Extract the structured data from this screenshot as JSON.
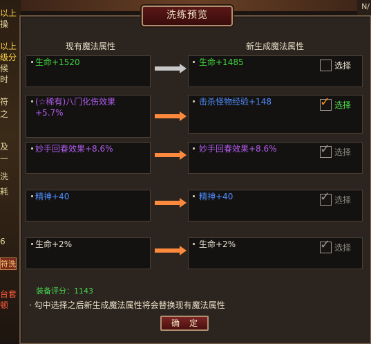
{
  "background": {
    "top_right_text": "N/",
    "left_fragments": [
      "以上",
      "操",
      "以上",
      "级分",
      "候",
      "时",
      "符",
      "之",
      "及",
      "一",
      "洗",
      "耗",
      "6",
      "台套",
      "顿"
    ],
    "left_button_label": "符洗"
  },
  "dialog": {
    "title": "洗练预览",
    "current_header": "现有魔法属性",
    "new_header": "新生成魔法属性",
    "rows": [
      {
        "current": "生命+1520",
        "current_color": "#3fd23f",
        "new": "生命+1485",
        "new_color": "#3fd23f",
        "checked": false,
        "check_label": "选择",
        "check_label_color": "#e8e0d0",
        "arrow": "gray"
      },
      {
        "current": "(☆稀有)八门化伤效果\n+5.7%",
        "current_color": "#b15cf0",
        "new": "击杀怪物经验+148",
        "new_color": "#4e8cff",
        "checked": true,
        "check_label": "选择",
        "check_label_color": "#4be04b",
        "arrow": "orange"
      },
      {
        "current": "妙手回春效果+8.6%",
        "current_color": "#b15cf0",
        "new": "妙手回春效果+8.6%",
        "new_color": "#b15cf0",
        "checked": true,
        "check_label": "选择",
        "check_label_color": "#8a8680",
        "arrow": "orange"
      },
      {
        "current": "精神+40",
        "current_color": "#4e8cff",
        "new": "精神+40",
        "new_color": "#4e8cff",
        "checked": true,
        "check_label": "选择",
        "check_label_color": "#8a8680",
        "arrow": "orange"
      },
      {
        "current": "生命+2%",
        "current_color": "#e8e0d0",
        "new": "生命+2%",
        "new_color": "#e8e0d0",
        "checked": true,
        "check_label": "选择",
        "check_label_color": "#8a8680",
        "arrow": "orange"
      }
    ],
    "score_label": "装备评分：1143",
    "note": "勾中选择之后新生成魔法属性将会替换现有魔法属性",
    "confirm_label": "确定"
  },
  "colors": {
    "arrow_orange": "#ff8a3d",
    "arrow_gray": "#c8c8c8",
    "tick_orange": "#ff8a1e",
    "tick_gray": "#9a9692"
  }
}
